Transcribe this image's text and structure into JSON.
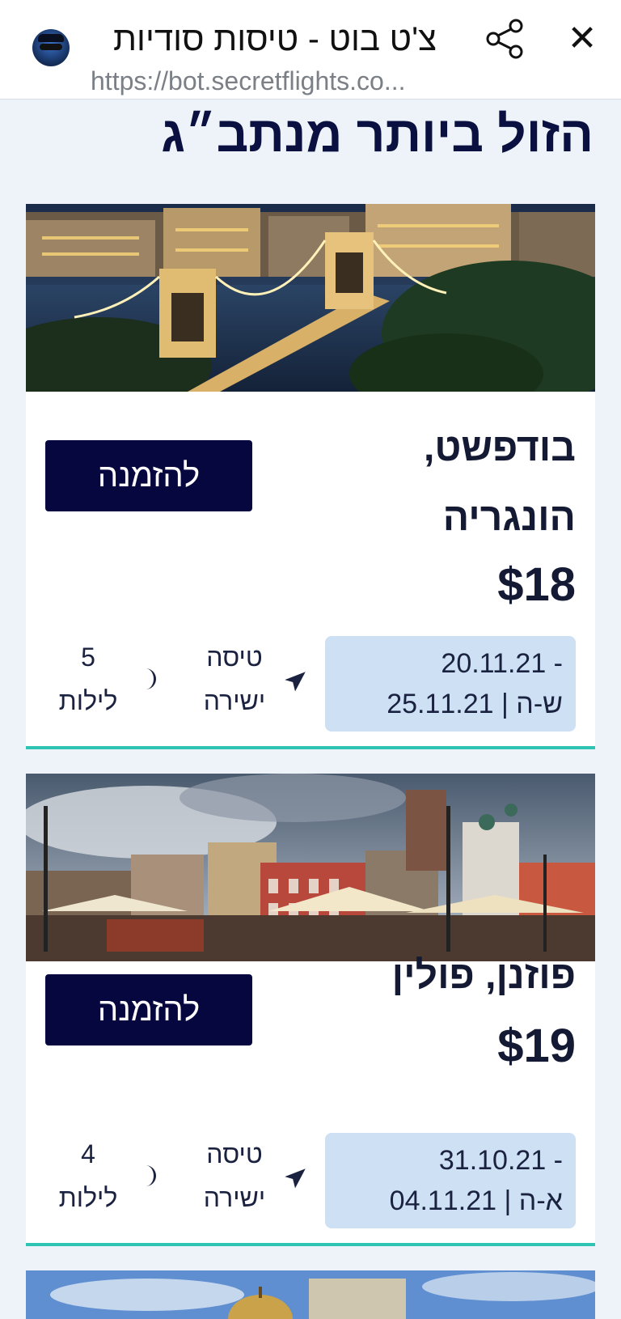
{
  "browser": {
    "title": "צ'ט בוט - טיסות סודיות",
    "url": "https://bot.secretflights.co...",
    "close_symbol": "✕"
  },
  "page": {
    "heading": "הזול ביותר מנתב״ג"
  },
  "deals": [
    {
      "destination_line1": "בודפשט,",
      "destination_line2": "הונגריה",
      "price": "$18",
      "book_label": "להזמנה",
      "dates_line1": "20.11.21 -",
      "dates_line2_dates": "25.11.21",
      "dates_line2_days": "ש-ה",
      "flight_type_line1": "טיסה",
      "flight_type_line2": "ישירה",
      "nights_count": "5",
      "nights_label": "לילות",
      "photo_icon": "chain-bridge-night-photo"
    },
    {
      "destination": "פוזנן, פולין",
      "price": "$19",
      "book_label": "להזמנה",
      "dates_line1": "31.10.21 -",
      "dates_line2_dates": "04.11.21",
      "dates_line2_days": "א-ה",
      "flight_type_line1": "טיסה",
      "flight_type_line2": "ישירה",
      "nights_count": "4",
      "nights_label": "לילות",
      "photo_icon": "old-town-square-photo"
    }
  ],
  "colors": {
    "background": "#eef3fa",
    "button": "#07073f",
    "accent_line": "#2fc3b4",
    "date_box": "#cde0f4",
    "heading": "#0a1040"
  }
}
